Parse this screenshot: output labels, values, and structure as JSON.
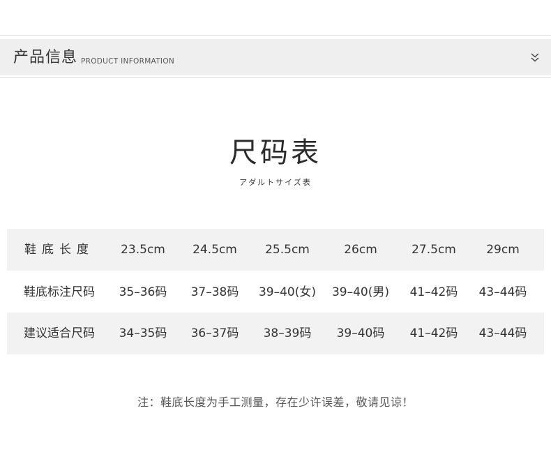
{
  "header": {
    "title": "产品信息",
    "subtitle": "PRODUCT INFORMATION",
    "toggle_icon": "double-chevron-down-icon"
  },
  "size_chart": {
    "title": "尺码表",
    "subtitle": "アダルトサイズ表",
    "rows": [
      {
        "label": "鞋底长度",
        "cells": [
          "23.5cm",
          "24.5cm",
          "25.5cm",
          "26cm",
          "27.5cm",
          "29cm"
        ]
      },
      {
        "label": "鞋底标注尺码",
        "cells": [
          "35–36码",
          "37–38码",
          "39–40(女)",
          "39–40(男)",
          "41–42码",
          "43–44码"
        ]
      },
      {
        "label": "建议适合尺码",
        "cells": [
          "34–35码",
          "36–37码",
          "38–39码",
          "39–40码",
          "41–42码",
          "43–44码"
        ]
      }
    ]
  },
  "footnote": "注：鞋底长度为手工测量，存在少许误差，敬请见谅！",
  "colors": {
    "header_background": "#efefef",
    "row_shade": "#f2f2f2",
    "text": "#333333"
  }
}
